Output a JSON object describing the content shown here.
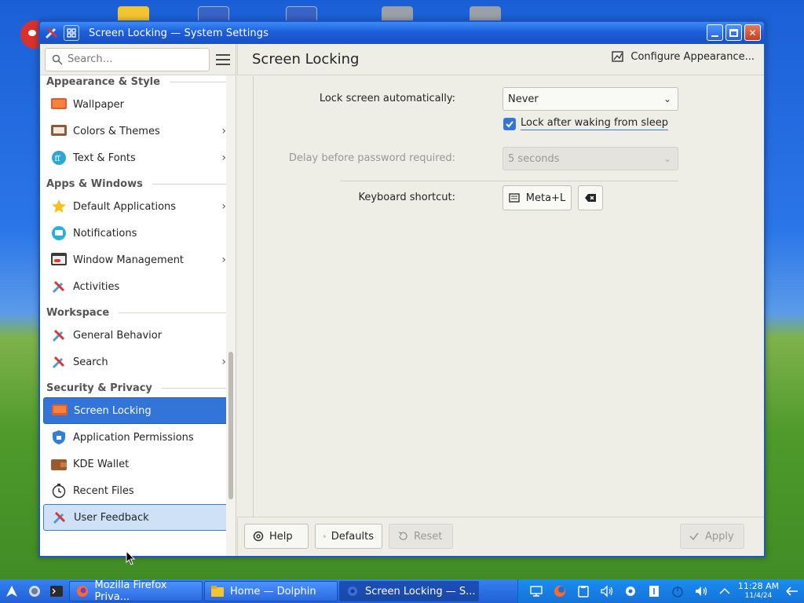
{
  "window": {
    "title": "Screen Locking — System Settings"
  },
  "sidebar": {
    "search_placeholder": "Search…",
    "sections": {
      "appearance": "Appearance & Style",
      "apps": "Apps & Windows",
      "workspace": "Workspace",
      "security": "Security & Privacy"
    },
    "items": {
      "wallpaper": "Wallpaper",
      "colors_themes": "Colors & Themes",
      "text_fonts": "Text & Fonts",
      "default_apps": "Default Applications",
      "notifications": "Notifications",
      "window_mgmt": "Window Management",
      "activities": "Activities",
      "general_behavior": "General Behavior",
      "search": "Search",
      "screen_locking": "Screen Locking",
      "app_permissions": "Application Permissions",
      "kde_wallet": "KDE Wallet",
      "recent_files": "Recent Files",
      "user_feedback": "User Feedback"
    }
  },
  "main": {
    "title": "Screen Locking",
    "configure_appearance": "Configure Appearance...",
    "lock_auto_label": "Lock screen automatically:",
    "lock_auto_value": "Never",
    "lock_after_sleep": "Lock after waking from sleep",
    "delay_label": "Delay before password required:",
    "delay_value": "5 seconds",
    "shortcut_label": "Keyboard shortcut:",
    "shortcut_value": "Meta+L"
  },
  "footer": {
    "help": "Help",
    "defaults": "Defaults",
    "reset": "Reset",
    "apply": "Apply"
  },
  "taskbar": {
    "tasks": {
      "firefox": "Mozilla Firefox Priva...",
      "dolphin": "Home — Dolphin",
      "settings": "Screen Locking — S..."
    },
    "clock_time": "11:28 AM",
    "clock_date": "11/4/24"
  },
  "colors": {
    "accent": "#3374d8",
    "titlebar": "#1d5fd9"
  }
}
